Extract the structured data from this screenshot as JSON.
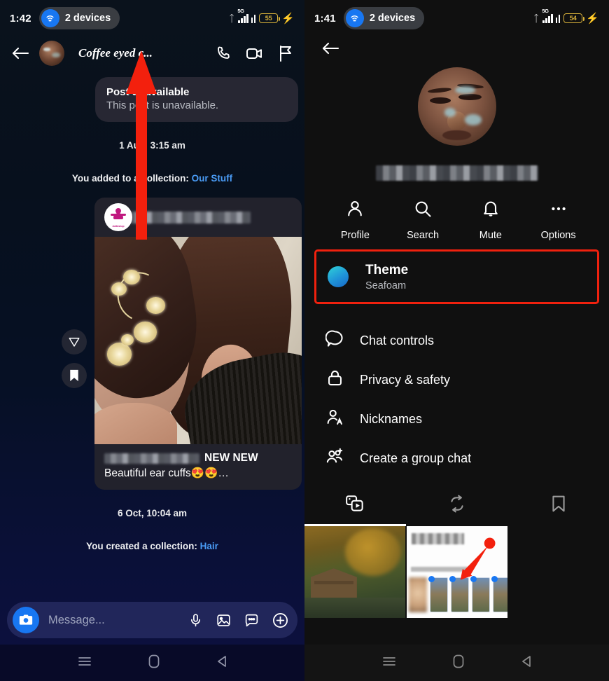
{
  "left": {
    "status": {
      "time": "1:42",
      "devices_label": "2 devices",
      "network": "5G",
      "battery": "55"
    },
    "header": {
      "back_icon": "back-arrow-icon",
      "title": "Coffee eyed c...",
      "call_icon": "phone-icon",
      "video_icon": "video-camera-icon",
      "flag_icon": "flag-icon"
    },
    "unavailable_bubble": {
      "title": "Post unavailable",
      "subtitle": "This post is unavailable."
    },
    "timestamp_1": "1  Aug, 3:15 am",
    "system_1": {
      "text": "You added to a collection: ",
      "link": "Our Stuff"
    },
    "post": {
      "author_redacted": true,
      "caption_new": "NEW NEW",
      "caption_line2": "Beautiful ear cuffs😍😍…",
      "share_icon": "send-icon",
      "save_icon": "bookmark-icon"
    },
    "timestamp_2": "6 Oct, 10:04 am",
    "system_2": {
      "text": "You created a collection: ",
      "link": "Hair"
    },
    "composer": {
      "camera_icon": "camera-icon",
      "placeholder": "Message...",
      "mic_icon": "microphone-icon",
      "gallery_icon": "image-icon",
      "sticker_icon": "sticker-icon",
      "plus_icon": "plus-circle-icon"
    },
    "navbar": {
      "recents_icon": "menu-icon",
      "home_icon": "home-icon",
      "back_icon": "back-triangle-icon"
    }
  },
  "right": {
    "status": {
      "time": "1:41",
      "devices_label": "2 devices",
      "network": "5G",
      "battery": "54"
    },
    "header": {
      "back_icon": "back-arrow-icon"
    },
    "profile": {
      "name_redacted": true
    },
    "actions": [
      {
        "label": "Profile",
        "icon": "person-icon"
      },
      {
        "label": "Search",
        "icon": "search-icon"
      },
      {
        "label": "Mute",
        "icon": "bell-icon"
      },
      {
        "label": "Options",
        "icon": "ellipsis-icon"
      }
    ],
    "theme": {
      "title": "Theme",
      "value": "Seafoam",
      "swatch_color": "#1f93d8",
      "highlight_color": "#f0210e"
    },
    "menu": [
      {
        "label": "Chat controls",
        "icon": "chat-bubble-icon"
      },
      {
        "label": "Privacy & safety",
        "icon": "lock-icon"
      },
      {
        "label": "Nicknames",
        "icon": "person-letter-icon"
      },
      {
        "label": "Create a group chat",
        "icon": "add-people-icon"
      }
    ],
    "tabs": [
      {
        "icon": "media-icon",
        "active": true
      },
      {
        "icon": "repeat-icon",
        "active": false
      },
      {
        "icon": "bookmark-icon",
        "active": false
      }
    ],
    "navbar": {
      "recents_icon": "menu-icon",
      "home_icon": "home-icon",
      "back_icon": "back-triangle-icon"
    }
  }
}
